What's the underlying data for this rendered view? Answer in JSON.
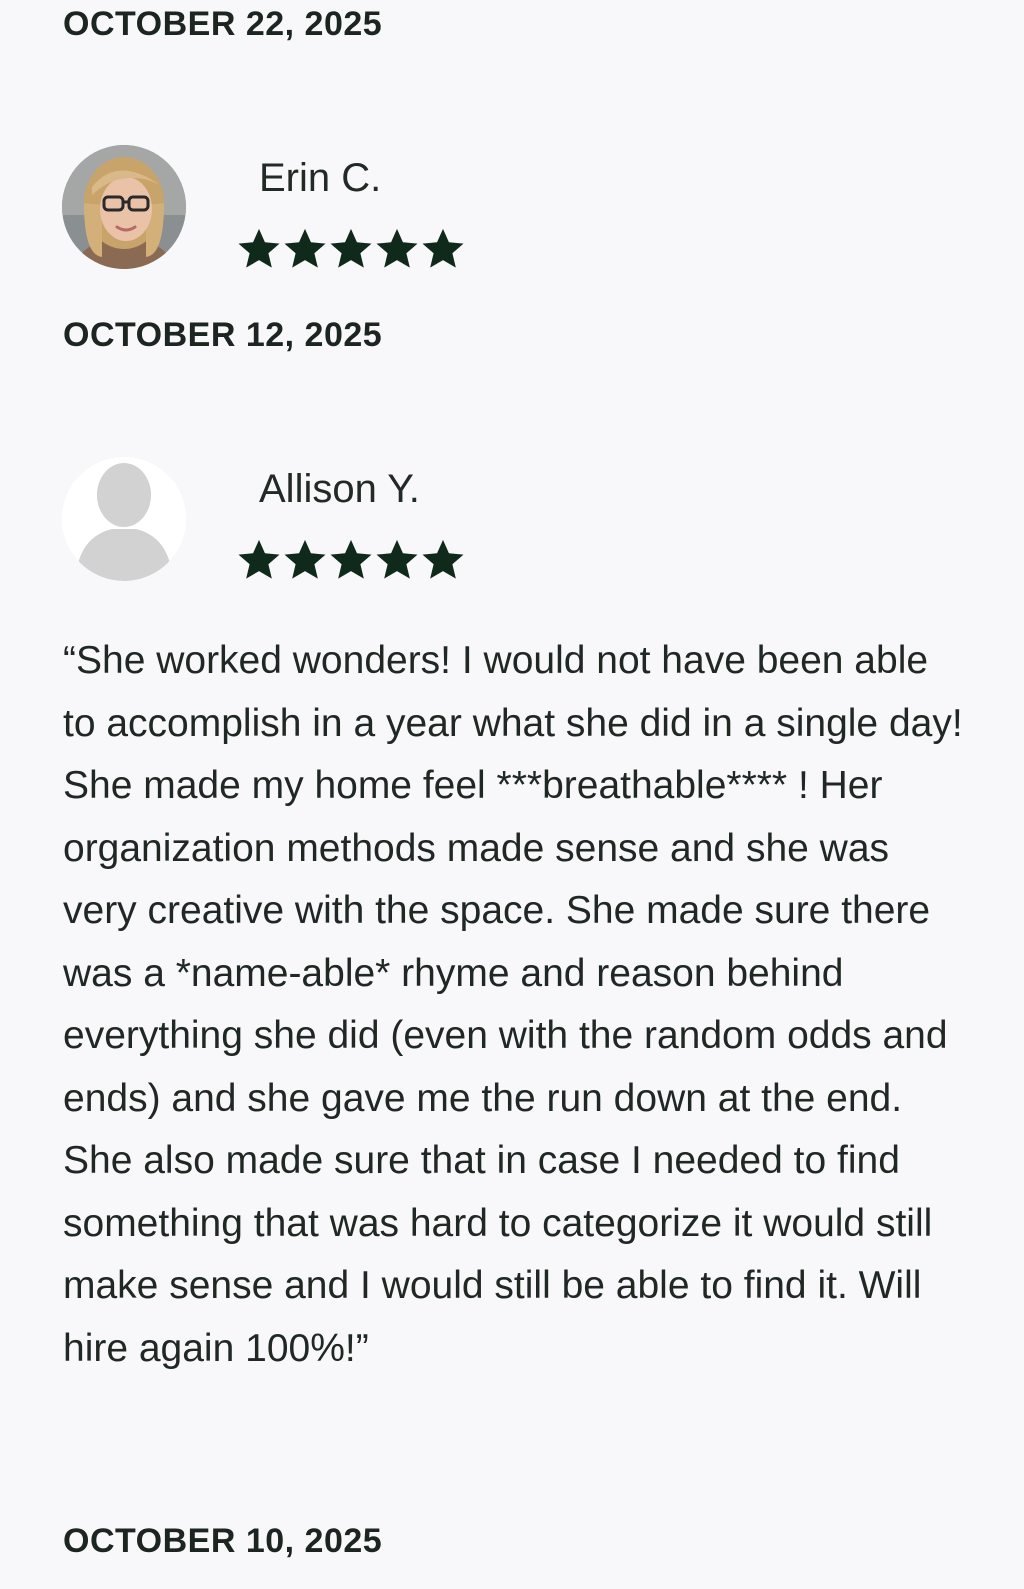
{
  "reviews": [
    {
      "date_above": "OCTOBER 22, 2025",
      "name": "Erin C.",
      "rating": 5,
      "avatar": "photo-avatar",
      "date_below": "OCTOBER 12, 2025"
    },
    {
      "name": "Allison Y.",
      "rating": 5,
      "avatar": "placeholder-person-icon",
      "text": "“She worked wonders! I would not have been able to accomplish in a year what she did in a single day! She made my home feel ***breathable**** ! Her organization methods made sense and she was very creative with the space. She made sure there was a *name-able* rhyme and reason behind everything she did (even with the random odds and ends) and she gave me the run down at the end. She also made sure that in case I needed to find something that was hard to categorize it would still make sense and I would still be able to find it. Will hire again 100%!”",
      "date_below": "OCTOBER 10, 2025"
    }
  ],
  "colors": {
    "background": "#f8f8fa",
    "star": "#0f2a1a",
    "text": "#202824"
  }
}
